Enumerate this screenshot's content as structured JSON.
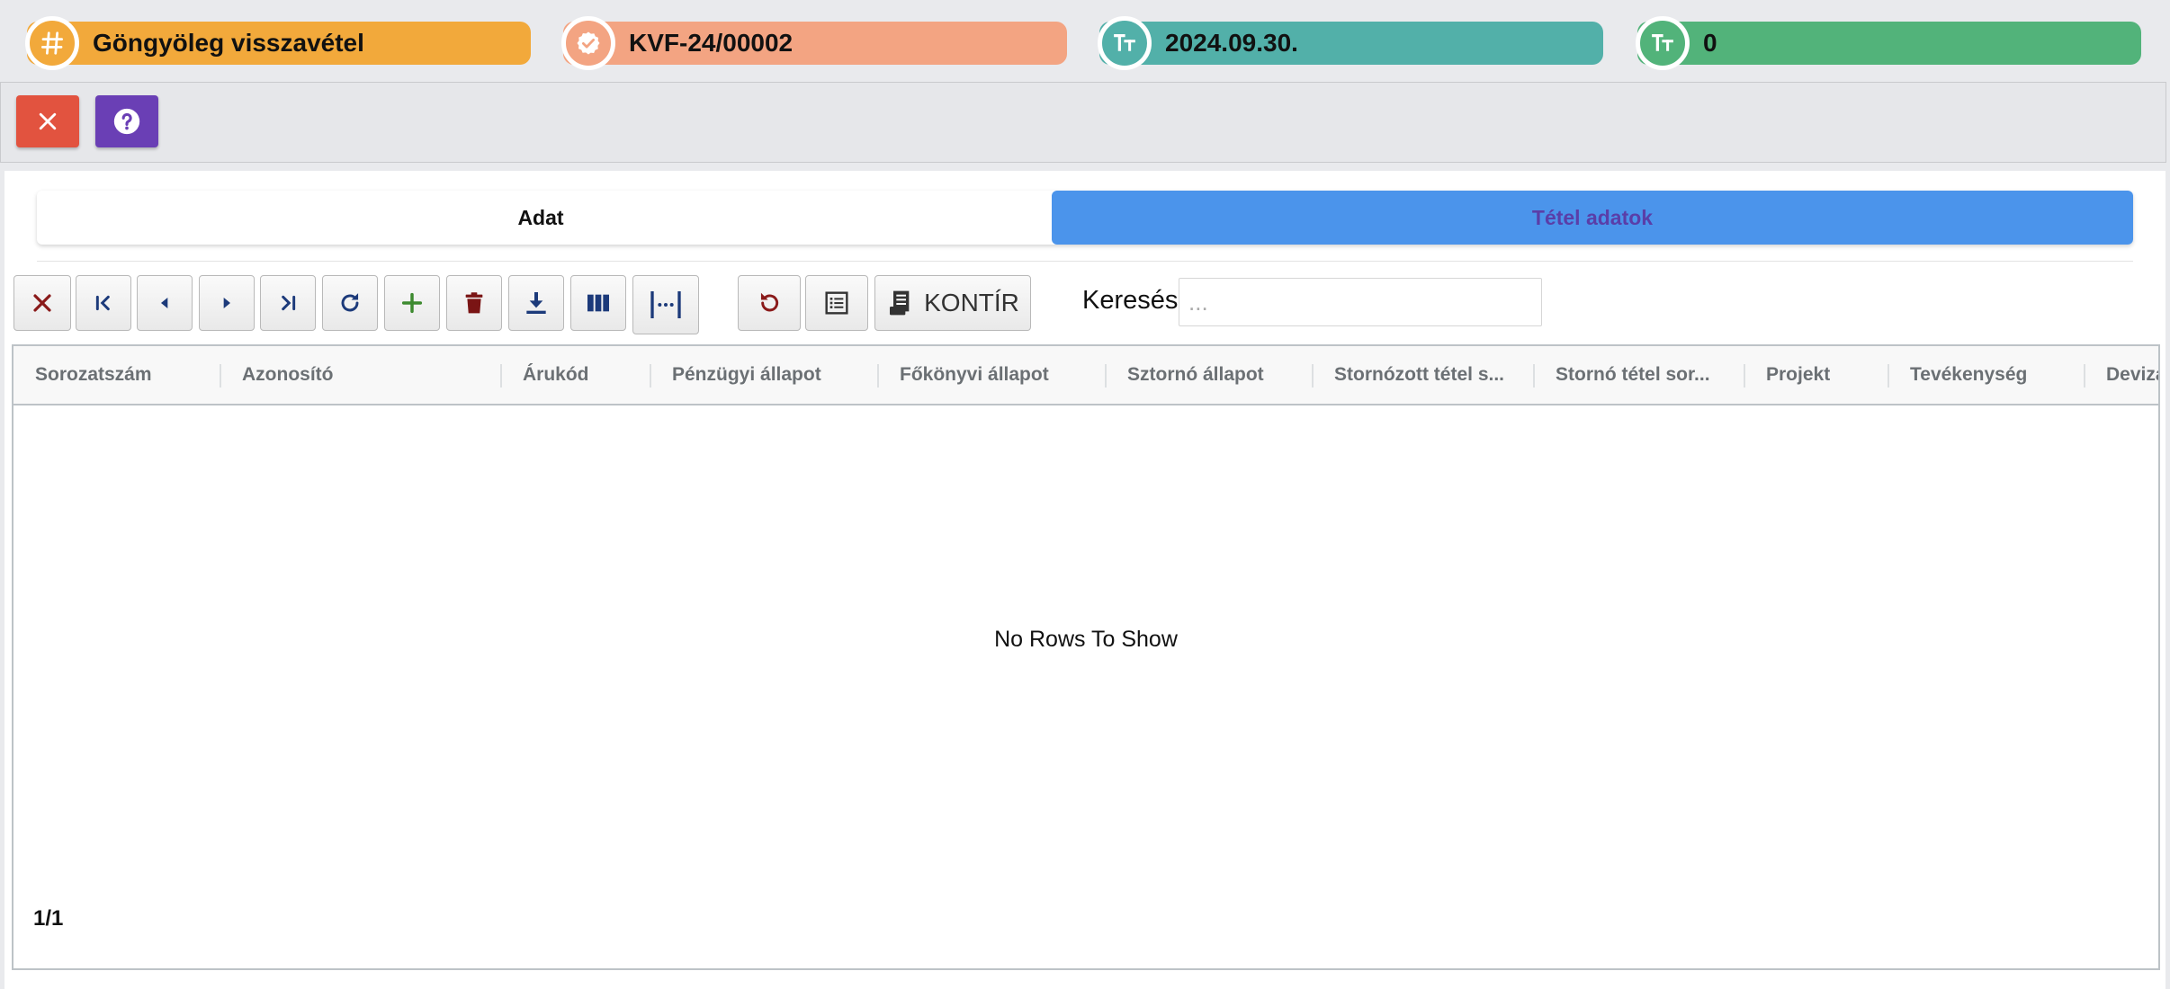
{
  "header": {
    "items": [
      {
        "icon": "hash-icon",
        "text": "Göngyöleg visszavétel",
        "color": "#f2a93b",
        "icon_color": "#f2a93b"
      },
      {
        "icon": "verified-badge-icon",
        "text": "KVF-24/00002",
        "color": "#f3a482",
        "icon_color": "#f3a482"
      },
      {
        "icon": "text-size-icon",
        "text": "2024.09.30.",
        "color": "#52b0a9",
        "icon_color": "#52b0a9"
      },
      {
        "icon": "text-size-icon",
        "text": "0",
        "color": "#52b37a",
        "icon_color": "#52b37a"
      }
    ]
  },
  "actions": {
    "close": {
      "icon": "close-icon",
      "color": "#e2533f"
    },
    "help": {
      "icon": "help-icon",
      "color": "#6a3fb5"
    }
  },
  "tabs": [
    {
      "label": "Adat",
      "active": false
    },
    {
      "label": "Tétel adatok",
      "active": true
    }
  ],
  "toolbar": {
    "buttons": [
      {
        "name": "cancel-button",
        "icon": "x-icon"
      },
      {
        "name": "first-record-button",
        "icon": "skip-first-icon"
      },
      {
        "name": "previous-record-button",
        "icon": "caret-left-icon"
      },
      {
        "name": "next-record-button",
        "icon": "caret-right-icon"
      },
      {
        "name": "last-record-button",
        "icon": "skip-last-icon"
      },
      {
        "name": "refresh-button",
        "icon": "refresh-icon"
      },
      {
        "name": "add-button",
        "icon": "plus-icon"
      },
      {
        "name": "delete-button",
        "icon": "trash-icon"
      },
      {
        "name": "download-button",
        "icon": "download-icon"
      },
      {
        "name": "columns-button",
        "icon": "columns-icon"
      },
      {
        "name": "fit-columns-button",
        "icon": "fit-width-icon"
      },
      {
        "name": "undo-button",
        "icon": "undo-icon"
      },
      {
        "name": "list-button",
        "icon": "list-icon"
      }
    ],
    "kontir_label": "KONTÍR",
    "search_label": "Keresés:",
    "search_placeholder": "..."
  },
  "grid": {
    "columns": [
      "Sorozatszám",
      "Azonosító",
      "Árukód",
      "Pénzügyi állapot",
      "Főkönyvi állapot",
      "Sztornó állapot",
      "Stornózott tétel s...",
      "Stornó tétel sor...",
      "Projekt",
      "Tevékenység",
      "Deviza"
    ],
    "rows": [],
    "empty_message": "No Rows To Show",
    "page_info": "1/1"
  }
}
